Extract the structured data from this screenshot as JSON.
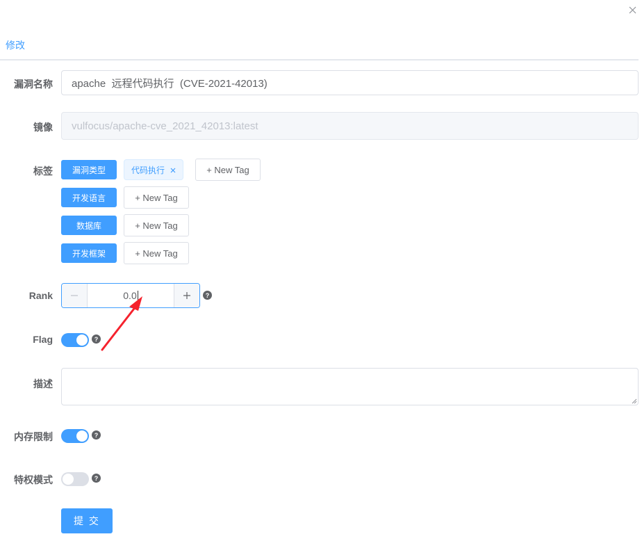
{
  "dialog": {
    "close_icon": "close-icon"
  },
  "tabs": [
    {
      "label": "修改",
      "active": true
    }
  ],
  "form": {
    "vuln_name": {
      "label": "漏洞名称",
      "value": "apache  远程代码执行  (CVE-2021-42013)"
    },
    "image": {
      "label": "镜像",
      "placeholder": "vulfocus/apache-cve_2021_42013:latest",
      "disabled": true
    },
    "tags": {
      "label": "标签",
      "categories": [
        {
          "label": "漏洞类型",
          "tags": [
            "代码执行"
          ],
          "new_tag_label": "+ New Tag"
        },
        {
          "label": "开发语言",
          "tags": [],
          "new_tag_label": "+ New Tag"
        },
        {
          "label": "数据库",
          "tags": [],
          "new_tag_label": "+ New Tag"
        },
        {
          "label": "开发框架",
          "tags": [],
          "new_tag_label": "+ New Tag"
        }
      ],
      "tag_close_icon": "close-icon"
    },
    "rank": {
      "label": "Rank",
      "value": "0.0",
      "decrement_icon": "minus-icon",
      "increment_icon": "plus-icon",
      "help_icon": "question-circle-icon"
    },
    "flag": {
      "label": "Flag",
      "enabled": true,
      "help_icon": "question-circle-icon"
    },
    "description": {
      "label": "描述",
      "value": ""
    },
    "memory_limit": {
      "label": "内存限制",
      "enabled": true,
      "help_icon": "question-circle-icon"
    },
    "privileged_mode": {
      "label": "特权模式",
      "enabled": false,
      "help_icon": "question-circle-icon"
    },
    "submit_label": "提 交"
  },
  "annotation": {
    "type": "arrow",
    "color": "#f5222d",
    "icon": "red-arrow-annotation"
  },
  "colors": {
    "primary": "#409eff",
    "tag_bg": "#ecf5ff",
    "border": "#dcdfe6",
    "disabled_bg": "#f5f7fa"
  }
}
